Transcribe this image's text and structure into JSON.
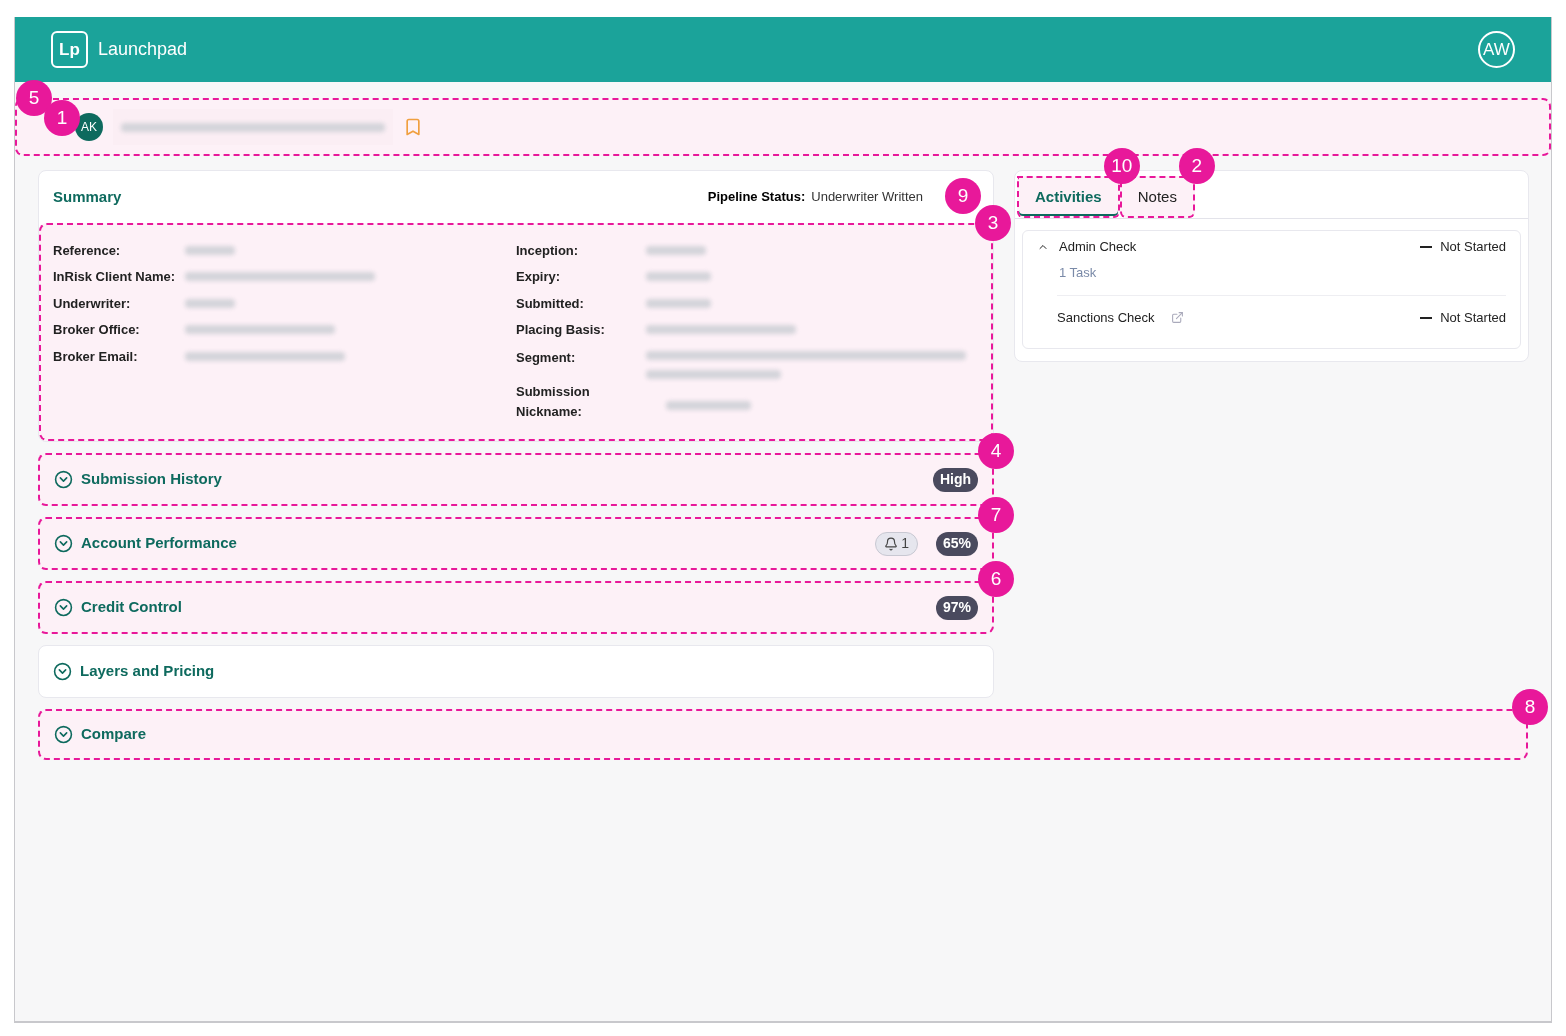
{
  "app": {
    "logo": "Lp",
    "name": "Launchpad",
    "user": "AW"
  },
  "title_bar": {
    "avatar": "AK",
    "highlighted": true,
    "markers": [
      "5",
      "1"
    ]
  },
  "summary": {
    "title": "Summary",
    "pipeline_label": "Pipeline Status:",
    "pipeline_value": "Underwriter Written",
    "marker": "9",
    "details": {
      "highlighted": true,
      "marker": "3",
      "left": [
        "Reference:",
        "InRisk Client Name:",
        "Underwriter:",
        "Broker Office:",
        "Broker Email:"
      ],
      "right": [
        "Inception:",
        "Expiry:",
        "Submitted:",
        "Placing Basis:",
        "Segment:",
        "Submission Nickname:"
      ]
    }
  },
  "sections": [
    {
      "title": "Submission History",
      "highlighted": true,
      "marker": "4",
      "badges": [
        {
          "kind": "pill",
          "text": "High"
        }
      ]
    },
    {
      "title": "Account Performance",
      "highlighted": true,
      "marker": "7",
      "badges": [
        {
          "kind": "bell",
          "text": "1"
        },
        {
          "kind": "pill",
          "text": "65%"
        }
      ]
    },
    {
      "title": "Credit Control",
      "highlighted": true,
      "marker": "6",
      "badges": [
        {
          "kind": "pill",
          "text": "97%"
        }
      ]
    },
    {
      "title": "Layers and Pricing",
      "highlighted": false
    }
  ],
  "compare": {
    "title": "Compare",
    "highlighted": true,
    "marker": "8"
  },
  "side_panel": {
    "tabs": [
      {
        "label": "Activities",
        "selected": true,
        "highlighted": true,
        "marker": "10"
      },
      {
        "label": "Notes",
        "selected": false,
        "highlighted": true,
        "marker": "2"
      }
    ],
    "activities": [
      {
        "name": "Admin Check",
        "expanded": true,
        "link": false,
        "tasks": "1 Task",
        "status": "Not Started"
      },
      {
        "name": "Sanctions Check",
        "expanded": false,
        "link": true,
        "status": "Not Started"
      }
    ]
  }
}
